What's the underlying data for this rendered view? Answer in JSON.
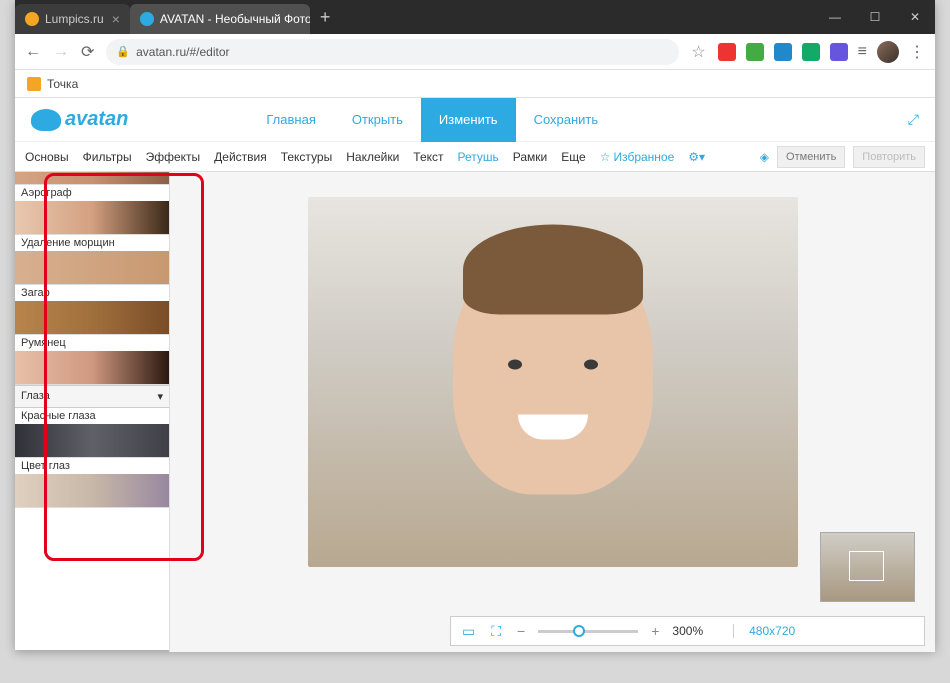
{
  "browser": {
    "tabs": [
      {
        "title": "Lumpics.ru",
        "active": false,
        "icon_color": "#f4a524"
      },
      {
        "title": "AVATAN - Необычный Фоторед",
        "active": true,
        "icon_color": "#2eaae2"
      }
    ],
    "url": "avatan.ru/#/editor",
    "bookmark": "Точка",
    "win": {
      "min": "—",
      "max": "☐",
      "close": "✕"
    }
  },
  "header": {
    "logo": "avatan",
    "nav": [
      {
        "label": "Главная",
        "key": "home"
      },
      {
        "label": "Открыть",
        "key": "open"
      },
      {
        "label": "Изменить",
        "key": "edit",
        "primary": true
      },
      {
        "label": "Сохранить",
        "key": "save"
      }
    ]
  },
  "toolbar": {
    "items": [
      "Основы",
      "Фильтры",
      "Эффекты",
      "Действия",
      "Текстуры",
      "Наклейки",
      "Текст",
      "Ретушь",
      "Рамки",
      "Еще"
    ],
    "active": "Ретушь",
    "favorites": "Избранное",
    "undo": "Отменить",
    "redo": "Повторить"
  },
  "sidebar": {
    "items": [
      {
        "label": "Аэрограф"
      },
      {
        "label": "Удаление морщин"
      },
      {
        "label": "Загар"
      },
      {
        "label": "Румянец"
      }
    ],
    "section": "Глаза",
    "items2": [
      {
        "label": "Красные глаза"
      },
      {
        "label": "Цвет глаз"
      }
    ]
  },
  "zoom": {
    "value": "300%",
    "dimensions": "480x720",
    "minus": "−",
    "plus": "+"
  }
}
